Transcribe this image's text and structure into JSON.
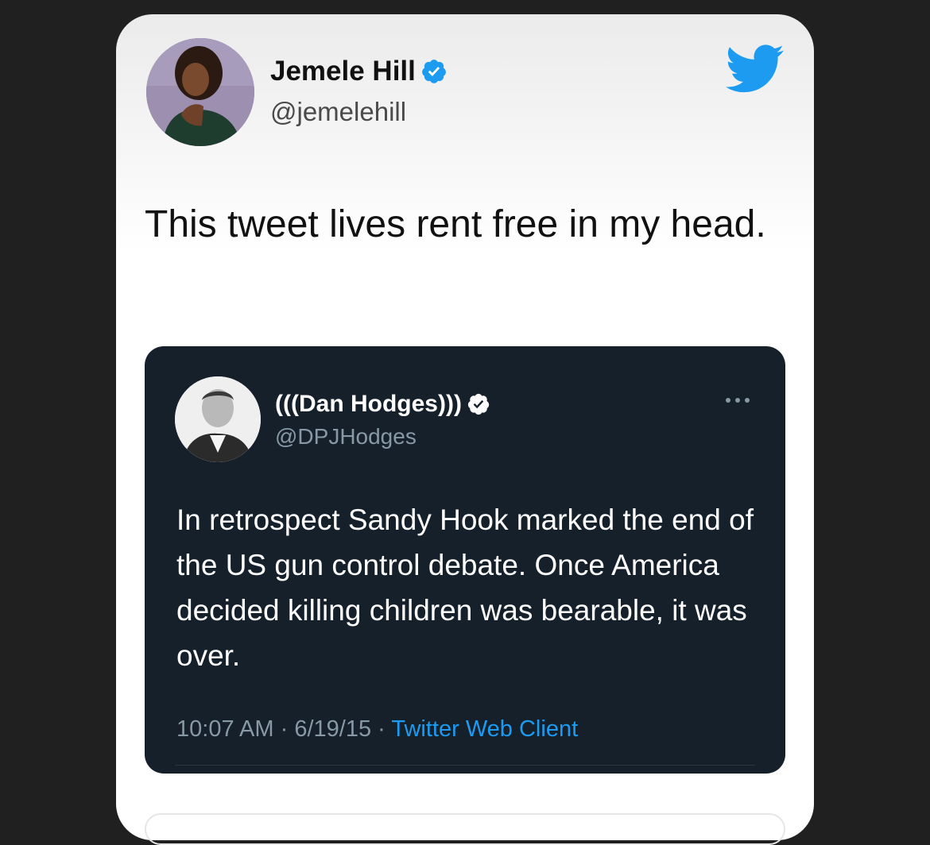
{
  "tweet": {
    "author": {
      "name": "Jemele Hill",
      "handle": "@jemelehill",
      "verified": true,
      "avatar_icon": "user-avatar"
    },
    "logo_icon": "twitter-bird-icon",
    "text": "This tweet lives rent free in my head.",
    "quoted_tweet": {
      "author": {
        "name": "(((Dan Hodges)))",
        "handle": "@DPJHodges",
        "verified": true,
        "avatar_icon": "user-avatar"
      },
      "more_icon": "more-options-icon",
      "text": "In retrospect Sandy Hook marked the end of the US gun control debate. Once America decided killing children was bearable, it was over.",
      "time": "10:07 AM",
      "separator": "·",
      "date": "6/19/15",
      "client": "Twitter Web Client"
    }
  },
  "colors": {
    "page_background": "#202020",
    "card_background": "#ffffff",
    "quote_background": "#15202b",
    "twitter_blue": "#1d9bf0",
    "muted_text": "#8899a6"
  }
}
